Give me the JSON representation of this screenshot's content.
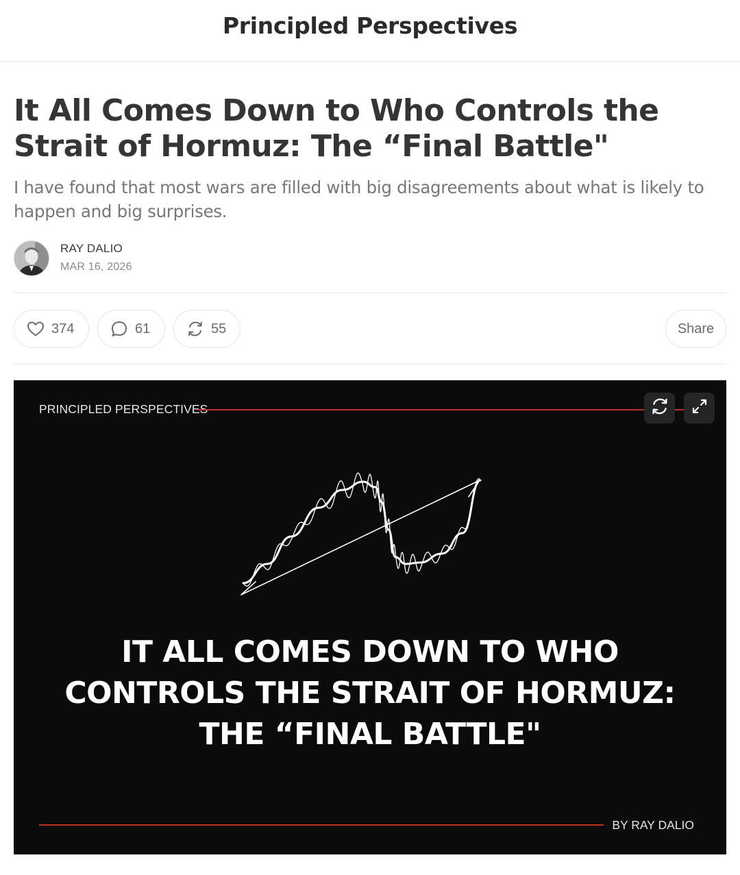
{
  "publication": {
    "name": "Principled Perspectives"
  },
  "post": {
    "title": "It All Comes Down to Who Controls the Strait of Hormuz: The “Final Battle\"",
    "subtitle": "I have found that most wars are filled with big disagreements about what is likely to happen and big surprises.",
    "author": "RAY DALIO",
    "date": "MAR 16, 2026"
  },
  "actions": {
    "likes": "374",
    "comments": "61",
    "restacks": "55",
    "share_label": "Share"
  },
  "icons": {
    "like": "heart-icon",
    "comment": "speech-bubble-icon",
    "restack": "restack-icon",
    "refresh": "refresh-icon",
    "expand": "expand-icon"
  },
  "hero": {
    "brand": "PRINCIPLED PERSPECTIVES",
    "headline_lines": [
      "IT ALL COMES DOWN TO WHO",
      "CONTROLS THE STRAIT OF HORMUZ:",
      "THE “FINAL BATTLE\""
    ],
    "byline": "BY RAY DALIO"
  },
  "colors": {
    "accent_red": "#c42b2b",
    "hero_background": "#0b0b0b",
    "text_dark": "#353535",
    "text_muted": "#777777"
  }
}
